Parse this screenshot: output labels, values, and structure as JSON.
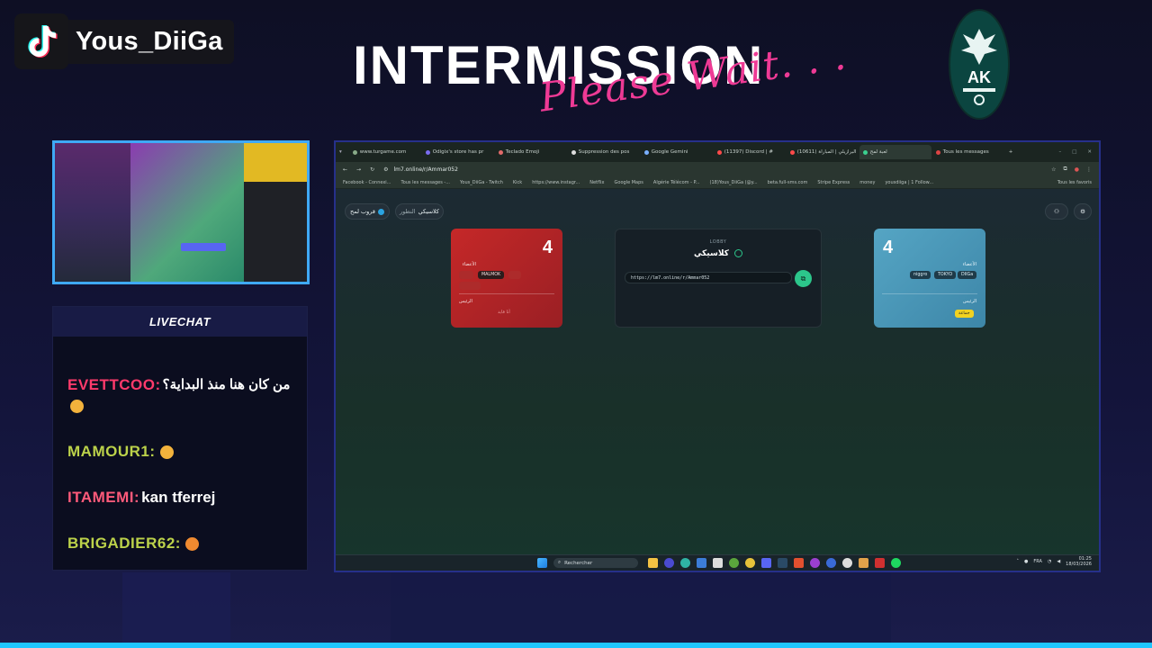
{
  "overlay": {
    "channel_name": "Yous_DiiGa",
    "title": "INTERMISSION",
    "subtitle": "Please Wait. . .",
    "livechat_label": "LIVECHAT",
    "colors": {
      "accent_pink": "#ee3a95",
      "frame_blue": "#3fa9f5",
      "bg": "#0e0f24"
    }
  },
  "chat": {
    "messages": [
      {
        "user": "EVETTCOO:",
        "text": "من كان هنا منذ البداية؟",
        "user_color": "#ff3a6b",
        "emoji": true
      },
      {
        "user": "MAMOUR1:",
        "text": "",
        "user_color": "#bcd24a",
        "emoji": true
      },
      {
        "user": "ITAMEMI:",
        "text": "kan tferrej",
        "user_color": "#ff5a7a",
        "emoji": false
      },
      {
        "user": "BRIGADIER62:",
        "text": "",
        "user_color": "#bcd24a",
        "emoji": true
      }
    ]
  },
  "browser": {
    "tabs": [
      {
        "title": "www.turgame.com"
      },
      {
        "title": "Odigix's store has pr"
      },
      {
        "title": "Teclado Emoji"
      },
      {
        "title": "Suppression des pos"
      },
      {
        "title": "Google Gemini"
      },
      {
        "title": "(11397) Discord | #"
      },
      {
        "title": "(10611) البرازيلي | المباراة"
      },
      {
        "title": "لعبة لمح",
        "active": true
      },
      {
        "title": "Tous les messages"
      }
    ],
    "url": "lm7.online/r/Ammar052",
    "bookmarks": [
      "Facebook - Connexi...",
      "Tous les messages -...",
      "Yous_DiiGa - Twitch",
      "Kick",
      "https://www.instagr...",
      "Netflix",
      "Google Maps",
      "Algérie Télécom - P...",
      "(18)Yous_DiiGa (@y...",
      "beta.full-sms.com",
      "Stripe Express",
      "money",
      "yousdiiga | 1 Follow...",
      "Tous les favoris"
    ]
  },
  "game": {
    "header_left_button": "قروب لمح",
    "header_mode": "كلاسيكي",
    "header_mode_label": "النطور",
    "red_team": {
      "score": "4",
      "players_label": "الأعضاء",
      "players": [
        "MALMOK"
      ],
      "captain_label": "الرئيس",
      "action": "أنا قايد"
    },
    "blue_team": {
      "score": "4",
      "players_label": "الأعضاء",
      "players": [
        "niggro",
        "TOKYO",
        "DIIGa"
      ],
      "captain_label": "الرئيس",
      "captain": "جماعة"
    },
    "lobby": {
      "tag": "LOBBY",
      "title": "كلاسيكي",
      "url": "https://lm7.online/r/Ammar052"
    }
  },
  "taskbar": {
    "search_placeholder": "Rechercher",
    "lang": "FRA",
    "time": "01:25",
    "date": "18/03/2026"
  }
}
